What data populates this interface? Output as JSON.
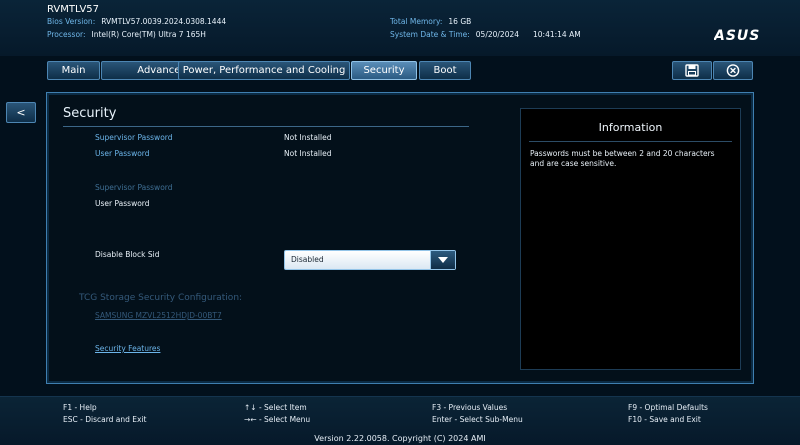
{
  "header": {
    "model": "RVMTLV57",
    "bios_label": "Bios Version:",
    "bios_value": "RVMTLV57.0039.2024.0308.1444",
    "processor_label": "Processor:",
    "processor_value": "Intel(R) Core(TM) Ultra 7 165H",
    "memory_label": "Total Memory:",
    "memory_value": "16 GB",
    "datetime_label": "System Date & Time:",
    "date_value": "05/20/2024",
    "time_value": "10:41:14 AM",
    "logo_text": "ASUS"
  },
  "tabs": [
    {
      "label": "Main"
    },
    {
      "label": "Advanced"
    },
    {
      "label": "Power, Performance and Cooling"
    },
    {
      "label": "Security"
    },
    {
      "label": "Boot"
    }
  ],
  "toolbar": {
    "save_icon": "save-icon",
    "exit_icon": "close-circle-icon"
  },
  "back_label": "<",
  "security": {
    "title": "Security",
    "supervisor_password_label": "Supervisor Password",
    "supervisor_password_value": "Not Installed",
    "user_password_label": "User Password",
    "user_password_value": "Not Installed",
    "set_supervisor_password": "Supervisor Password",
    "set_user_password": "User Password",
    "disable_block_sid_label": "Disable Block Sid",
    "disable_block_sid_value": "Disabled",
    "tcg_label": "TCG Storage Security Configuration:",
    "tcg_device": "SAMSUNG MZVL2512HDJD-00BT7",
    "security_features": "Security Features"
  },
  "information": {
    "title": "Information",
    "text": "Passwords must be between 2 and 20 characters and are case sensitive."
  },
  "hotkeys": {
    "f1": "F1 - Help",
    "esc": "ESC - Discard and Exit",
    "arrows_ud": "↑↓ - Select Item",
    "arrows_lr": "→← - Select Menu",
    "f3": "F3 - Previous Values",
    "enter": "Enter - Select Sub-Menu",
    "f9": "F9 - Optimal Defaults",
    "f10": "F10 - Save and Exit"
  },
  "version": "Version 2.22.0058. Copyright (C) 2024 AMI",
  "colors": {
    "accent": "#6cb5ea",
    "panel_border": "#3f7fb0",
    "background": "#02101c"
  }
}
